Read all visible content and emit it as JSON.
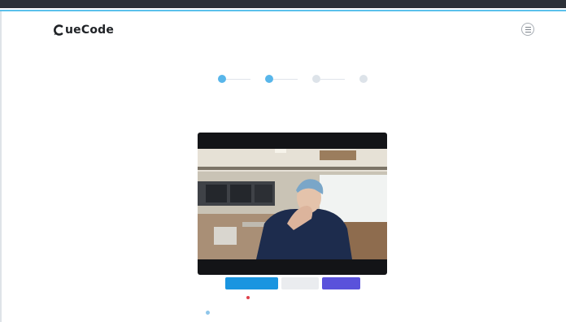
{
  "app": {
    "logo_text": "ueCode",
    "logo_mark": "C-logo"
  },
  "header": {
    "menu_icon": "hamburger-icon"
  },
  "stepper": {
    "steps": [
      {
        "label": "",
        "state": "active"
      },
      {
        "label": "",
        "state": "active"
      },
      {
        "label": "",
        "state": "inactive"
      },
      {
        "label": "",
        "state": "inactive"
      }
    ]
  },
  "section": {
    "title": ""
  },
  "video": {
    "description_icon": "camera-preview"
  },
  "actions": {
    "blue_label": "",
    "grey_label": "",
    "purple_label": ""
  },
  "warning": {
    "text": ""
  },
  "colors": {
    "accent": "#58b6ea",
    "primary_button": "#1a95e0",
    "next_button": "#5a52db",
    "warning": "#e0414b",
    "topbar": "#2c3138"
  }
}
